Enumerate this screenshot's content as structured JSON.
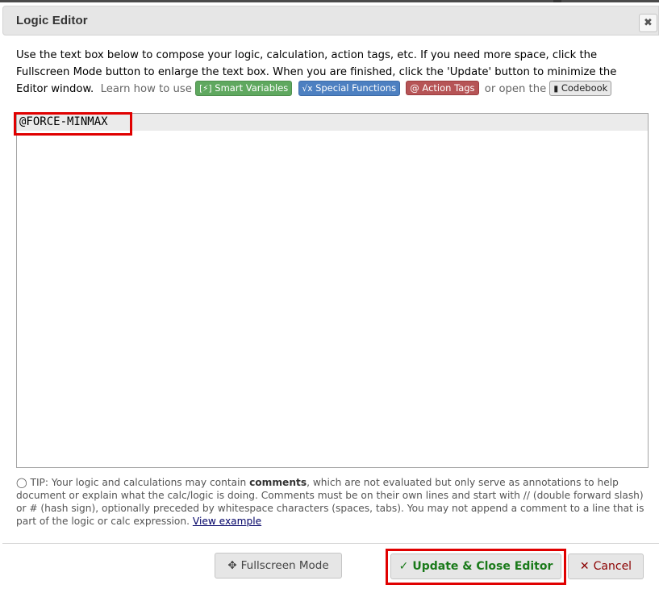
{
  "dialog": {
    "title": "Logic Editor",
    "close_icon": "close-icon"
  },
  "intro": {
    "text": "Use the text box below to compose your logic, calculation, action tags, etc. If you need more space, click the Fullscreen Mode button to enlarge the text box. When you are finished, click the 'Update' button to minimize the Editor window.",
    "learn_prefix": "Learn how to use",
    "or_open": "or open the",
    "badges": {
      "smart_variables": {
        "icon": "[⚡]",
        "label": "Smart Variables",
        "color": "#5fa85f"
      },
      "special_functions": {
        "icon": "√x",
        "label": "Special Functions",
        "color": "#4d80c1"
      },
      "action_tags": {
        "icon": "@",
        "label": "Action Tags",
        "color": "#b65456"
      },
      "codebook": {
        "icon": "book-icon",
        "label": "Codebook",
        "color": "#e8e8e8"
      }
    }
  },
  "editor": {
    "lines": [
      "@FORCE-MINMAX"
    ]
  },
  "tip": {
    "icon": "lightbulb-icon",
    "prefix": "TIP: Your logic and calculations may contain ",
    "bold": "comments",
    "rest": ", which are not evaluated but only serve as annotations to help document or explain what the calc/logic is doing. Comments must be on their own lines and start with // (double forward slash) or # (hash sign), optionally preceded by whitespace characters (spaces, tabs). You may not append a comment to a line that is part of the logic or calc expression. ",
    "link": "View example"
  },
  "footer": {
    "fullscreen_label": "Fullscreen Mode",
    "update_label": "Update & Close Editor",
    "cancel_label": "Cancel"
  },
  "highlight_color": "#e00000"
}
